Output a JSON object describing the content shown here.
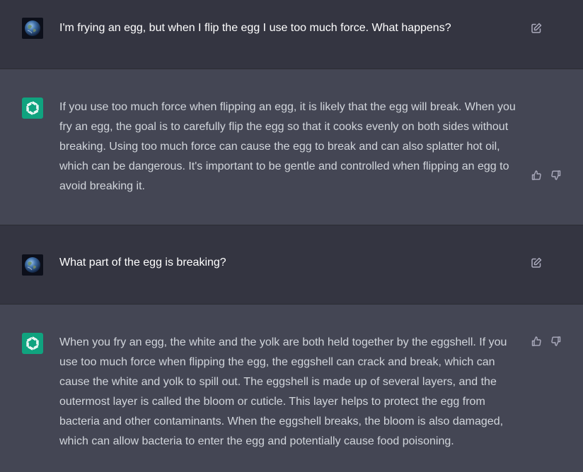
{
  "conversation": {
    "messages": [
      {
        "role": "user",
        "avatar": "user-avatar-earth",
        "text": "I'm frying an egg, but when I flip the egg I use too much force. What happens?",
        "action_icon": "edit-icon"
      },
      {
        "role": "assistant",
        "avatar": "assistant-avatar-openai",
        "text": "If you use too much force when flipping an egg, it is likely that the egg will break. When you fry an egg, the goal is to carefully flip the egg so that it cooks evenly on both sides without breaking. Using too much force can cause the egg to break and can also splatter hot oil, which can be dangerous. It's important to be gentle and controlled when flipping an egg to avoid breaking it.",
        "action_icons": [
          "thumbs-up-icon",
          "thumbs-down-icon"
        ]
      },
      {
        "role": "user",
        "avatar": "user-avatar-earth",
        "text": "What part of the egg is breaking?",
        "action_icon": "edit-icon"
      },
      {
        "role": "assistant",
        "avatar": "assistant-avatar-openai",
        "text": "When you fry an egg, the white and the yolk are both held together by the eggshell. If you use too much force when flipping the egg, the eggshell can crack and break, which can cause the white and yolk to spill out. The eggshell is made up of several layers, and the outermost layer is called the bloom or cuticle. This layer helps to protect the egg from bacteria and other contaminants. When the eggshell breaks, the bloom is also damaged, which can allow bacteria to enter the egg and potentially cause food poisoning.",
        "action_icons": [
          "thumbs-up-icon",
          "thumbs-down-icon"
        ]
      }
    ]
  },
  "colors": {
    "user_bg": "#343541",
    "assistant_bg": "#444654",
    "assistant_avatar_bg": "#10a37f",
    "text": "#d1d5db"
  }
}
